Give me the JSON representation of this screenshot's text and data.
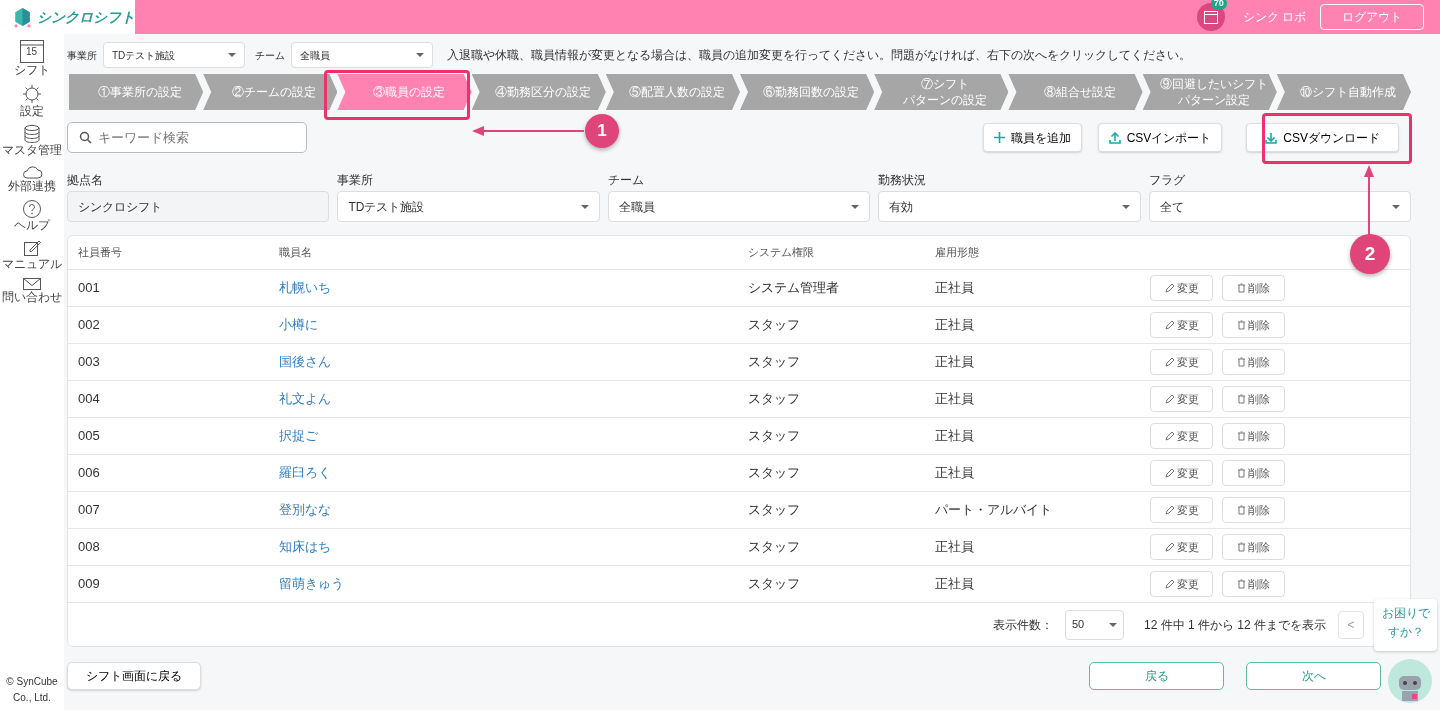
{
  "header": {
    "logo_text": "シンクロシフト",
    "notification_count": "70",
    "user_name": "シンク ロボ",
    "logout": "ログアウト"
  },
  "sidebar": {
    "items": [
      {
        "label": "シフト",
        "badge": "15"
      },
      {
        "label": "設定"
      },
      {
        "label": "マスタ管理"
      },
      {
        "label": "外部連携"
      },
      {
        "label": "ヘルプ"
      },
      {
        "label": "マニュアル"
      },
      {
        "label": "問い合わせ"
      }
    ],
    "copyright": [
      "© SynCube",
      "Co., Ltd."
    ]
  },
  "toolbar": {
    "office_label": "事業所",
    "office_value": "TDテスト施設",
    "team_label": "チーム",
    "team_value": "全職員",
    "notice": "入退職や休職、職員情報が変更となる場合は、職員の追加変更を行ってください。問題がなければ、右下の次へをクリックしてください。"
  },
  "steps": [
    {
      "lines": [
        "①事業所の設定"
      ],
      "selected": false
    },
    {
      "lines": [
        "②チームの設定"
      ],
      "selected": false
    },
    {
      "lines": [
        "③職員の設定"
      ],
      "selected": true
    },
    {
      "lines": [
        "④勤務区分の設定"
      ],
      "selected": false
    },
    {
      "lines": [
        "⑤配置人数の設定"
      ],
      "selected": false
    },
    {
      "lines": [
        "⑥勤務回数の設定"
      ],
      "selected": false
    },
    {
      "lines": [
        "⑦シフト",
        "パターンの設定"
      ],
      "selected": false
    },
    {
      "lines": [
        "⑧組合せ設定"
      ],
      "selected": false
    },
    {
      "lines": [
        "⑨回避したいシフト",
        "パターン設定"
      ],
      "selected": false
    },
    {
      "lines": [
        "⑩シフト自動作成"
      ],
      "selected": false
    }
  ],
  "search": {
    "placeholder": "キーワード検索"
  },
  "actions": [
    {
      "label": "職員を追加",
      "kind": "add"
    },
    {
      "label": "CSVインポート",
      "kind": "import"
    },
    {
      "label": "CSVダウンロード",
      "kind": "download"
    }
  ],
  "filters": [
    {
      "label": "拠点名",
      "value": "シンクロシフト",
      "kind": "text"
    },
    {
      "label": "事業所",
      "value": "TDテスト施設",
      "kind": "select"
    },
    {
      "label": "チーム",
      "value": "全職員",
      "kind": "select"
    },
    {
      "label": "勤務状況",
      "value": "有効",
      "kind": "select"
    },
    {
      "label": "フラグ",
      "value": "全て",
      "kind": "select"
    }
  ],
  "table": {
    "columns": [
      "社員番号",
      "職員名",
      "システム権限",
      "雇用形態"
    ],
    "rows": [
      {
        "cells": [
          "001",
          "札幌いち",
          "システム管理者",
          "正社員"
        ],
        "actions": [
          "変更",
          "削除"
        ]
      },
      {
        "cells": [
          "002",
          "小樽に",
          "スタッフ",
          "正社員"
        ],
        "actions": [
          "変更",
          "削除"
        ]
      },
      {
        "cells": [
          "003",
          "国後さん",
          "スタッフ",
          "正社員"
        ],
        "actions": [
          "変更",
          "削除"
        ]
      },
      {
        "cells": [
          "004",
          "礼文よん",
          "スタッフ",
          "正社員"
        ],
        "actions": [
          "変更",
          "削除"
        ]
      },
      {
        "cells": [
          "005",
          "択捉ご",
          "スタッフ",
          "正社員"
        ],
        "actions": [
          "変更",
          "削除"
        ]
      },
      {
        "cells": [
          "006",
          "羅臼ろく",
          "スタッフ",
          "正社員"
        ],
        "actions": [
          "変更",
          "削除"
        ]
      },
      {
        "cells": [
          "007",
          "登別なな",
          "スタッフ",
          "パート・アルバイト"
        ],
        "actions": [
          "変更",
          "削除"
        ]
      },
      {
        "cells": [
          "008",
          "知床はち",
          "スタッフ",
          "正社員"
        ],
        "actions": [
          "変更",
          "削除"
        ]
      },
      {
        "cells": [
          "009",
          "留萌きゅう",
          "スタッフ",
          "正社員"
        ],
        "actions": [
          "変更",
          "削除"
        ]
      }
    ]
  },
  "pagination": {
    "per_page_label": "表示件数：",
    "per_page": "50",
    "summary": "12 件中 1 件から 12 件までを表示",
    "prev": "<"
  },
  "footer": {
    "back_to_shift": "シフト画面に戻る",
    "back": "戻る",
    "next": "次へ"
  },
  "help_bubble": [
    "お困りで",
    "すか？"
  ],
  "annotations": [
    {
      "number": "1",
      "kind": "step"
    },
    {
      "number": "2",
      "kind": "download"
    }
  ]
}
